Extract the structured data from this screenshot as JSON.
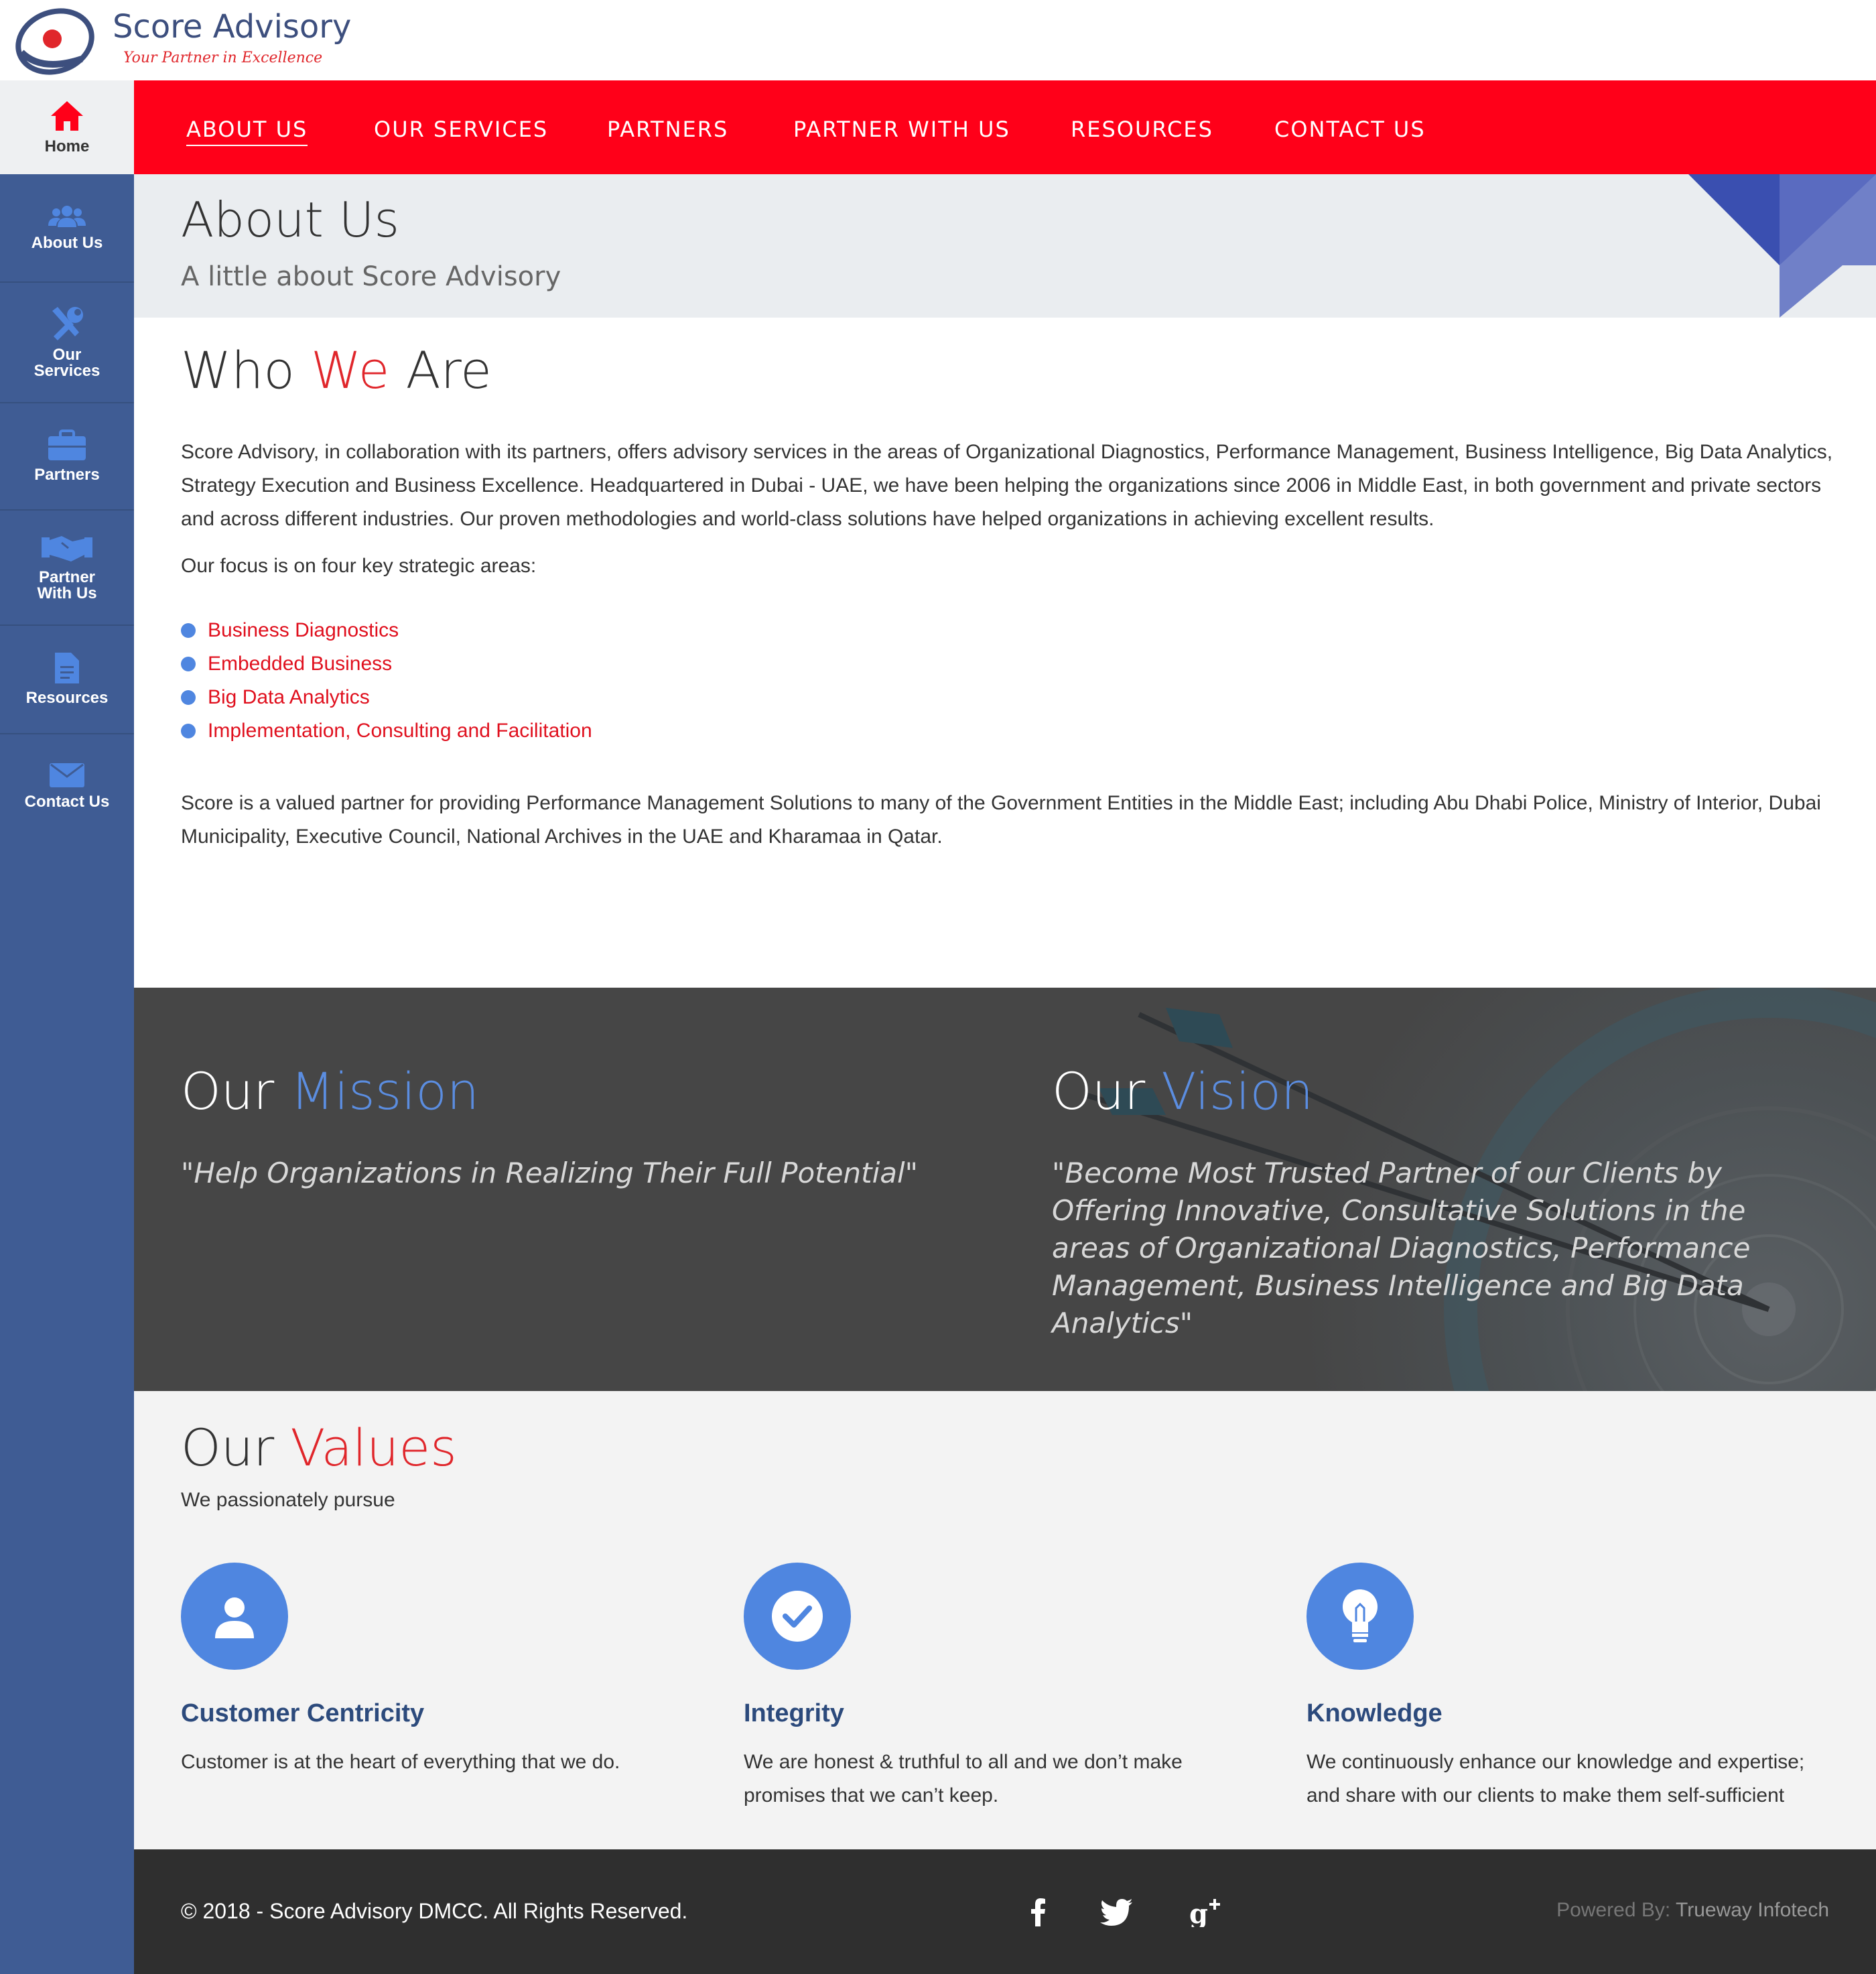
{
  "brand": {
    "name": "Score Advisory",
    "tagline": "Your Partner in Excellence"
  },
  "sidebar": {
    "items": [
      {
        "label": "Home",
        "icon": "home-icon"
      },
      {
        "label": "About Us",
        "icon": "users-icon"
      },
      {
        "label": "Our Services",
        "icon": "tools-icon"
      },
      {
        "label": "Partners",
        "icon": "briefcase-icon"
      },
      {
        "label": "Partner With Us",
        "icon": "handshake-icon"
      },
      {
        "label": "Resources",
        "icon": "document-icon"
      },
      {
        "label": "Contact Us",
        "icon": "envelope-icon"
      }
    ],
    "labels": {
      "home": "Home",
      "about": "About Us",
      "services_1": "Our",
      "services_2": "Services",
      "partners": "Partners",
      "partner_with_1": "Partner",
      "partner_with_2": "With Us",
      "resources": "Resources",
      "contact": "Contact Us"
    }
  },
  "topnav": {
    "items": [
      "ABOUT US",
      "OUR SERVICES",
      "PARTNERS",
      "PARTNER WITH US",
      "RESOURCES",
      "CONTACT US"
    ],
    "active": "ABOUT US"
  },
  "banner": {
    "title": "About Us",
    "subtitle": "A little about Score Advisory"
  },
  "who": {
    "title_a": "Who ",
    "title_b": "We",
    "title_c": " Are",
    "intro": "Score Advisory, in collaboration with its partners, offers advisory services in the areas of Organizational Diagnostics, Performance Management, Business Intelligence, Big Data Analytics, Strategy Execution and Business Excellence. Headquartered in Dubai - UAE, we have been helping the organizations since 2006 in Middle East, in both government and private sectors and across different industries. Our proven methodologies and world-class solutions have helped organizations in achieving excellent results.",
    "focus_intro": "Our focus is on four key strategic areas:",
    "focus_areas": [
      "Business Diagnostics",
      "Embedded Business",
      "Big Data Analytics",
      "Implementation, Consulting and Facilitation"
    ],
    "partners_text": "Score is a valued partner for providing Performance Management Solutions to many of the Government Entities in the Middle East; including Abu Dhabi Police, Ministry of Interior, Dubai Municipality, Executive Council, National Archives in the UAE and Kharamaa in Qatar."
  },
  "mission": {
    "title_a": "Our ",
    "title_b": "Mission",
    "text": "\"Help Organizations in Realizing Their Full Potential\""
  },
  "vision": {
    "title_a": "Our ",
    "title_b": "Vision",
    "text": "\"Become Most Trusted Partner of our Clients by Offering Innovative, Consultative Solutions in the areas of Organizational Diagnostics, Performance Management, Business Intelligence and Big Data Analytics\""
  },
  "values": {
    "title_a": "Our ",
    "title_b": "Values",
    "subtitle": "We passionately pursue",
    "items": [
      {
        "title": "Customer Centricity",
        "desc": "Customer is at the heart of everything that we do.",
        "icon": "user-icon"
      },
      {
        "title": "Integrity",
        "desc": "We are honest & truthful to all and we don’t make promises that we can’t keep.",
        "icon": "checkmark-icon"
      },
      {
        "title": "Knowledge",
        "desc": "We continuously enhance our knowledge and expertise; and share with our clients to make them self-sufficient",
        "icon": "lightbulb-icon"
      }
    ]
  },
  "footer": {
    "copyright": "© 2018 - Score Advisory DMCC. All Rights Reserved.",
    "social": [
      "facebook-icon",
      "twitter-icon",
      "google-plus-icon"
    ],
    "powered_label": "Powered By: ",
    "powered_brand": "Trueway Infotech"
  },
  "colors": {
    "nav_red": "#ff0019",
    "sidebar_blue": "#3f5c94",
    "accent_blue": "#4f86e0",
    "accent_red": "#e0262b",
    "footer_dark": "#2f2f2f"
  }
}
